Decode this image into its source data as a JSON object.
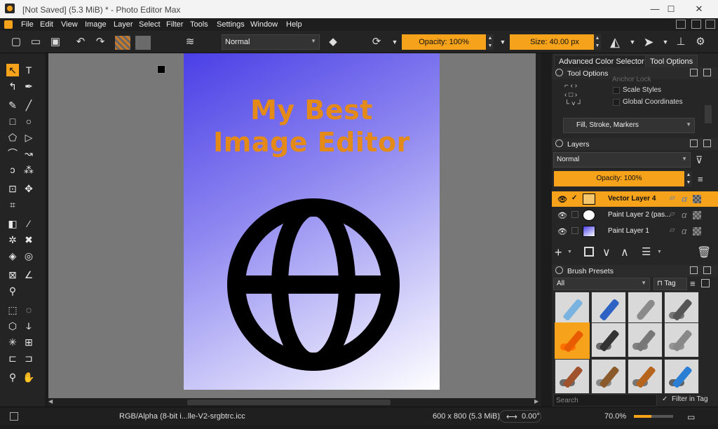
{
  "window": {
    "title": "[Not Saved]  (5.3 MiB) * - Photo Editor Max",
    "minimize": "—",
    "maximize": "☐",
    "close": "✕"
  },
  "menu": [
    "File",
    "Edit",
    "View",
    "Image",
    "Layer",
    "Select",
    "Filter",
    "Tools",
    "Settings",
    "Window",
    "Help"
  ],
  "toolbar": {
    "blend_mode": "Normal",
    "opacity_label": "Opacity: 100%",
    "size_label": "Size: 40.00 px",
    "icons": [
      "new-document-icon",
      "open-icon",
      "save-icon",
      "undo-icon",
      "redo-icon",
      "pattern-icon",
      "gradient-icon",
      "swap-colors-icon",
      "brush-presets-icon",
      "brush-icon",
      "eraser-icon",
      "alpha-lock-icon",
      "reload-icon",
      "mirror-horizontal-icon",
      "mirror-vertical-icon",
      "wrap-around-icon"
    ]
  },
  "colors": {
    "accent": "#f7a21b",
    "fg_color": "#000000",
    "bg_color": "#ffffff",
    "title_text": "#e48a19"
  },
  "document": {
    "title_line1": "My Best",
    "title_line2": "Image Editor",
    "icon": "globe-icon"
  },
  "right_panel": {
    "tabs": [
      "Advanced Color Selector",
      "Tool Options"
    ],
    "active_tab": "Tool Options",
    "tool_options": {
      "header": "Tool Options",
      "anchor_lock": "Anchor Lock",
      "scale_styles": "Scale Styles",
      "global_coordinates": "Global Coordinates",
      "fill_stroke": "Fill, Stroke, Markers"
    },
    "layers": {
      "header": "Layers",
      "blend_mode": "Normal",
      "opacity_label": "Opacity: 100%",
      "items": [
        {
          "name": "Vector Layer 4",
          "selected": true
        },
        {
          "name": "Paint Layer 2 (pas...",
          "selected": false
        },
        {
          "name": "Paint Layer 1",
          "selected": false
        }
      ]
    },
    "brush_presets": {
      "header": "Brush Presets",
      "filter": "All",
      "tag_label": "Tag",
      "search_placeholder": "Search",
      "filter_in_tag": "Filter in Tag"
    }
  },
  "status": {
    "color_profile": "RGB/Alpha (8-bit i...lle-V2-srgbtrc.icc",
    "dimensions": "600 x 800 (5.3 MiB)",
    "rotation": "0.00°",
    "zoom": "70.0%"
  }
}
